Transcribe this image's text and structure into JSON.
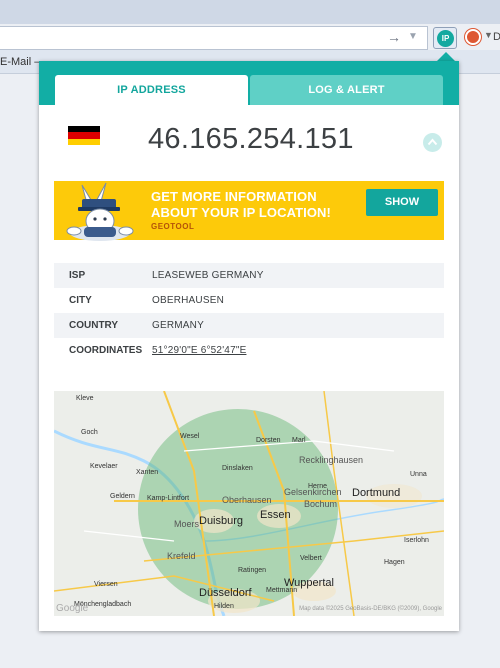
{
  "browser": {
    "bookmark_text": "E-Mail – ...",
    "ddg_text": "D",
    "ext_label": "IP"
  },
  "tabs": [
    {
      "label": "IP ADDRESS",
      "active": true
    },
    {
      "label": "LOG & ALERT",
      "active": false
    }
  ],
  "ip": {
    "address": "46.165.254.151",
    "country_flag": "germany-flag",
    "flag_colors": [
      "#000000",
      "#dd0000",
      "#ffce00"
    ]
  },
  "banner": {
    "headline_line1": "GET MORE INFORMATION",
    "headline_line2": "ABOUT YOUR IP LOCATION!",
    "brand": "GEOTOOL",
    "button_label": "SHOW",
    "bg_color": "#fdca0a"
  },
  "info": [
    {
      "key": "ISP",
      "value": "LEASEWEB GERMANY"
    },
    {
      "key": "CITY",
      "value": "OBERHAUSEN"
    },
    {
      "key": "COUNTRY",
      "value": "GERMANY"
    },
    {
      "key": "COORDINATES",
      "value": "51°29'0\"E 6°52'47\"E"
    }
  ],
  "map": {
    "cities_big": [
      "Duisburg",
      "Essen",
      "Düsseldorf",
      "Wuppertal",
      "Dortmund"
    ],
    "cities_mid": [
      "Bochum",
      "Gelsenkirchen",
      "Oberhausen",
      "Recklinghausen",
      "Krefeld",
      "Moers"
    ],
    "cities_small": [
      "Kleve",
      "Goch",
      "Wesel",
      "Dorsten",
      "Marl",
      "Herne",
      "Kevelaer",
      "Geldern",
      "Xanten",
      "Kamp-Lintfort",
      "Dinslaken",
      "Ratingen",
      "Velbert",
      "Hagen",
      "Iserlohn",
      "Mönchengladbach",
      "Viersen",
      "Mettmann",
      "Hilden",
      "Unna"
    ],
    "google_logo": "Google",
    "attribution": "Map data ©2025 GeoBasis-DE/BKG (©2009), Google",
    "radius_color": "#5fb46e"
  },
  "colors": {
    "accent": "#13a69d",
    "tab_inactive": "#5fd0c6",
    "text": "#3c4043"
  }
}
